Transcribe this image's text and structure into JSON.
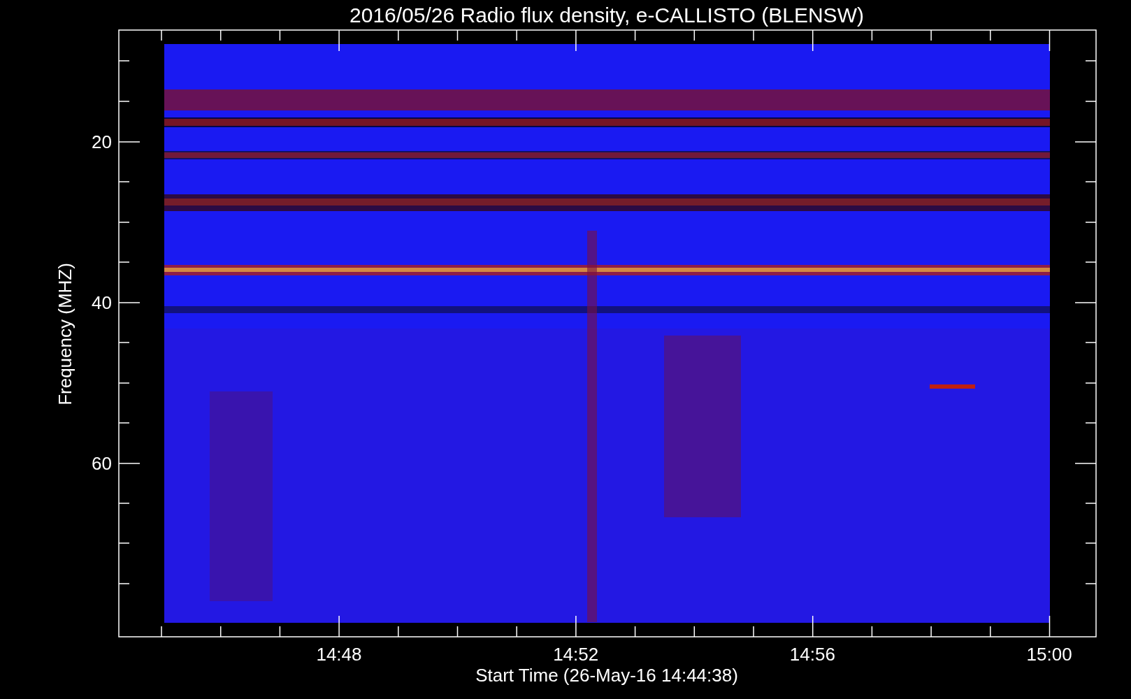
{
  "title": "2016/05/26  Radio flux density, e-CALLISTO (BLENSW)",
  "plot": {
    "ylabel": "Frequency (MHZ)",
    "xlabel": "Start Time (26-May-16 14:44:38)",
    "yticks": [
      "20",
      "40",
      "60"
    ],
    "xticks": [
      "14:48",
      "14:52",
      "14:56",
      "15:00"
    ]
  }
}
